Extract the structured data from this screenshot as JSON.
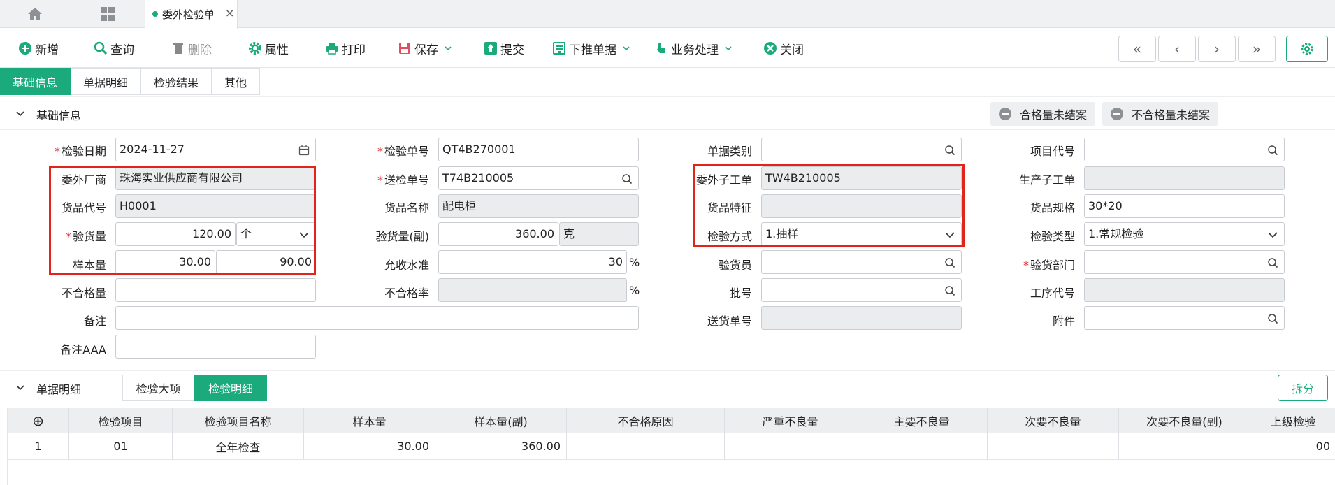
{
  "tabs": {
    "doc_title": "委外检验单",
    "close": "×"
  },
  "toolbar": {
    "new": "新增",
    "query": "查询",
    "delete": "删除",
    "props": "属性",
    "print": "打印",
    "save": "保存",
    "submit": "提交",
    "push_down": "下推单据",
    "business": "业务处理",
    "close": "关闭",
    "first": "«",
    "prev": "‹",
    "next": "›",
    "last": "»"
  },
  "section_tabs": [
    "基础信息",
    "单据明细",
    "检验结果",
    "其他"
  ],
  "basic_group": {
    "title": "基础信息",
    "chip_pass": "合格量未结案",
    "chip_fail": "不合格量未结案"
  },
  "form": {
    "inspect_date": {
      "label": "检验日期",
      "value": "2024-11-27"
    },
    "inspect_no": {
      "label": "检验单号",
      "value": "QT4B270001"
    },
    "doc_type": {
      "label": "单据类别",
      "value": ""
    },
    "project_code": {
      "label": "项目代号",
      "value": ""
    },
    "vendor": {
      "label": "委外厂商",
      "value": "珠海实业供应商有限公司"
    },
    "send_no": {
      "label": "送检单号",
      "value": "T74B210005"
    },
    "sub_order": {
      "label": "委外子工单",
      "value": "TW4B210005"
    },
    "prod_sub_order": {
      "label": "生产子工单",
      "value": ""
    },
    "item_code": {
      "label": "货品代号",
      "value": "H0001"
    },
    "item_name": {
      "label": "货品名称",
      "value": "配电柜"
    },
    "item_feature": {
      "label": "货品特征",
      "value": ""
    },
    "item_spec": {
      "label": "货品规格",
      "value": "30*20"
    },
    "qty": {
      "label": "验货量",
      "value": "120.00",
      "unit": "个"
    },
    "qty_sub": {
      "label": "验货量(副)",
      "value": "360.00",
      "unit": "克"
    },
    "method": {
      "label": "检验方式",
      "value": "1.抽样"
    },
    "inspect_type": {
      "label": "检验类型",
      "value": "1.常规检验"
    },
    "sample": {
      "label": "样本量",
      "value": "30.00",
      "value2": "90.00"
    },
    "accept_level": {
      "label": "允收水准",
      "value": "30",
      "unit": "%"
    },
    "inspector": {
      "label": "验货员",
      "value": ""
    },
    "dept": {
      "label": "验货部门",
      "value": ""
    },
    "defect_qty": {
      "label": "不合格量",
      "value": ""
    },
    "defect_rate": {
      "label": "不合格率",
      "value": "",
      "unit": "%"
    },
    "batch": {
      "label": "批号",
      "value": ""
    },
    "process_code": {
      "label": "工序代号",
      "value": ""
    },
    "remark": {
      "label": "备注",
      "value": ""
    },
    "delivery_no": {
      "label": "送货单号",
      "value": ""
    },
    "attachment": {
      "label": "附件",
      "value": ""
    },
    "remark_aaa": {
      "label": "备注AAA",
      "value": ""
    }
  },
  "detail": {
    "title": "单据明细",
    "tabs": [
      "检验大项",
      "检验明细"
    ],
    "split": "拆分",
    "add": "⊕",
    "columns": [
      "检验项目",
      "检验项目名称",
      "样本量",
      "样本量(副)",
      "不合格原因",
      "严重不良量",
      "主要不良量",
      "次要不良量",
      "次要不良量(副)",
      "上级检验"
    ],
    "rows": [
      {
        "idx": "1",
        "item": "01",
        "name": "全年检查",
        "sample": "30.00",
        "sample_sub": "360.00",
        "reason": "",
        "severe": "",
        "major": "",
        "minor": "",
        "minor_sub": "",
        "parent": "00"
      }
    ]
  },
  "colors": {
    "accent": "#1aaa7c",
    "highlight": "#e2231a"
  }
}
